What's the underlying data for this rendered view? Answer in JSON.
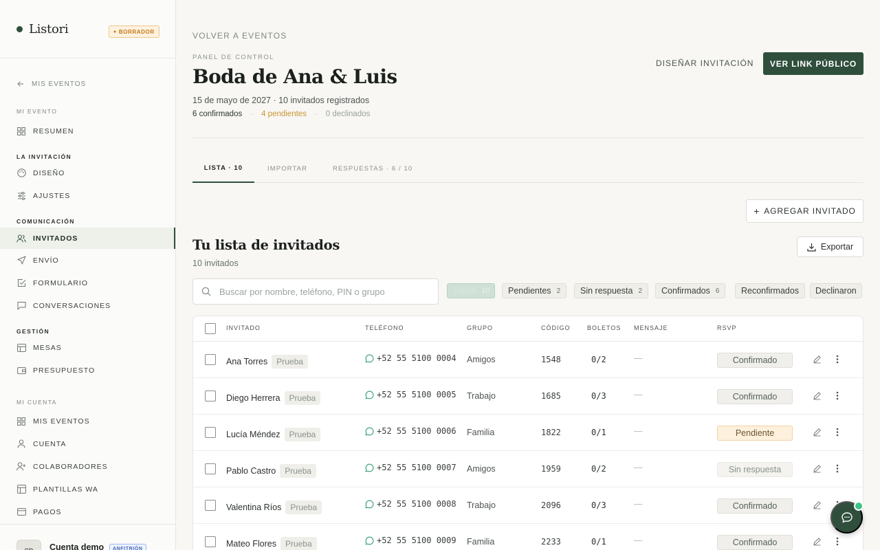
{
  "brand": {
    "name": "Listori",
    "badge": "BORRADOR"
  },
  "sidebar": {
    "back_label": "MIS EVENTOS",
    "sections": {
      "mi_evento": "MI EVENTO",
      "invitacion": "LA INVITACIÓN",
      "comunicacion": "COMUNICACIÓN",
      "gestion": "GESTIÓN",
      "mi_cuenta": "MI CUENTA"
    },
    "items": [
      {
        "label": "RESUMEN",
        "icon": "grid-icon"
      },
      {
        "label": "DISEÑO",
        "icon": "palette-icon"
      },
      {
        "label": "AJUSTES",
        "icon": "sliders-icon"
      },
      {
        "label": "INVITADOS",
        "icon": "users-icon",
        "active": true
      },
      {
        "label": "ENVÍO",
        "icon": "send-icon"
      },
      {
        "label": "FORMULARIO",
        "icon": "checklist-icon"
      },
      {
        "label": "CONVERSACIONES",
        "icon": "chat-icon"
      },
      {
        "label": "MESAS",
        "icon": "table-icon"
      },
      {
        "label": "PRESUPUESTO",
        "icon": "wallet-icon"
      },
      {
        "label": "MIS EVENTOS",
        "icon": "grid-icon"
      },
      {
        "label": "CUENTA",
        "icon": "user-icon"
      },
      {
        "label": "COLABORADORES",
        "icon": "user-plus-icon"
      },
      {
        "label": "PLANTILLAS WA",
        "icon": "template-icon"
      },
      {
        "label": "PAGOS",
        "icon": "card-icon"
      }
    ],
    "account": {
      "initials": "CD",
      "name": "Cuenta demo",
      "role": "ANFITRIÓN"
    }
  },
  "header": {
    "back_label": "VOLVER A EVENTOS",
    "overline": "PANEL DE CONTROL",
    "title": "Boda de Ana & Luis",
    "subtitle": "15 de mayo de 2027 · 10 invitados registrados",
    "stats": {
      "confirmed": "6 confirmados",
      "pending": "4 pendientes",
      "declined": "0 declinados"
    },
    "design_button": "DISEÑAR INVITACIÓN",
    "public_button": "VER LINK PÚBLICO"
  },
  "tabs": [
    {
      "label": "LISTA · 10",
      "active": true
    },
    {
      "label": "IMPORTAR"
    },
    {
      "label": "RESPUESTAS · 6 / 10"
    }
  ],
  "list": {
    "add_button": "AGREGAR INVITADO",
    "title": "Tu lista de invitados",
    "count": "10 invitados",
    "export_button": "Exportar",
    "search_placeholder": "Buscar por nombre, teléfono, PIN o grupo",
    "filters": [
      {
        "label": "Todos",
        "count": "10",
        "selected": true
      },
      {
        "label": "Pendientes",
        "count": "2"
      },
      {
        "label": "Sin respuesta",
        "count": "2"
      },
      {
        "label": "Confirmados",
        "count": "6"
      },
      {
        "label": "Reconfirmados",
        "count": ""
      },
      {
        "label": "Declinaron",
        "count": ""
      }
    ]
  },
  "table": {
    "columns": [
      "INVITADO",
      "TELÉFONO",
      "GRUPO",
      "CÓDIGO",
      "BOLETOS",
      "MENSAJE",
      "RSVP"
    ],
    "rows": [
      {
        "name": "Ana Torres",
        "tag": "Prueba",
        "phone": "+52 55 5100 0004",
        "group": "Amigos",
        "code": "1548",
        "tickets": "0/2",
        "message": "—",
        "rsvp": "Confirmado",
        "status": "ok"
      },
      {
        "name": "Diego Herrera",
        "tag": "Prueba",
        "phone": "+52 55 5100 0005",
        "group": "Trabajo",
        "code": "1685",
        "tickets": "0/3",
        "message": "—",
        "rsvp": "Confirmado",
        "status": "ok"
      },
      {
        "name": "Lucía Méndez",
        "tag": "Prueba",
        "phone": "+52 55 5100 0006",
        "group": "Familia",
        "code": "1822",
        "tickets": "0/1",
        "message": "—",
        "rsvp": "Pendiente",
        "status": "pend"
      },
      {
        "name": "Pablo Castro",
        "tag": "Prueba",
        "phone": "+52 55 5100 0007",
        "group": "Amigos",
        "code": "1959",
        "tickets": "0/2",
        "message": "—",
        "rsvp": "Sin respuesta",
        "status": "none"
      },
      {
        "name": "Valentina Ríos",
        "tag": "Prueba",
        "phone": "+52 55 5100 0008",
        "group": "Trabajo",
        "code": "2096",
        "tickets": "0/3",
        "message": "—",
        "rsvp": "Confirmado",
        "status": "ok"
      },
      {
        "name": "Mateo Flores",
        "tag": "Prueba",
        "phone": "+52 55 5100 0009",
        "group": "Familia",
        "code": "2233",
        "tickets": "0/1",
        "message": "—",
        "rsvp": "Confirmado",
        "status": "ok"
      }
    ]
  },
  "colors": {
    "accent": "#2f4f3c",
    "pending": "#c9952f",
    "badge": "#c47a16",
    "notify": "#3ec387"
  }
}
